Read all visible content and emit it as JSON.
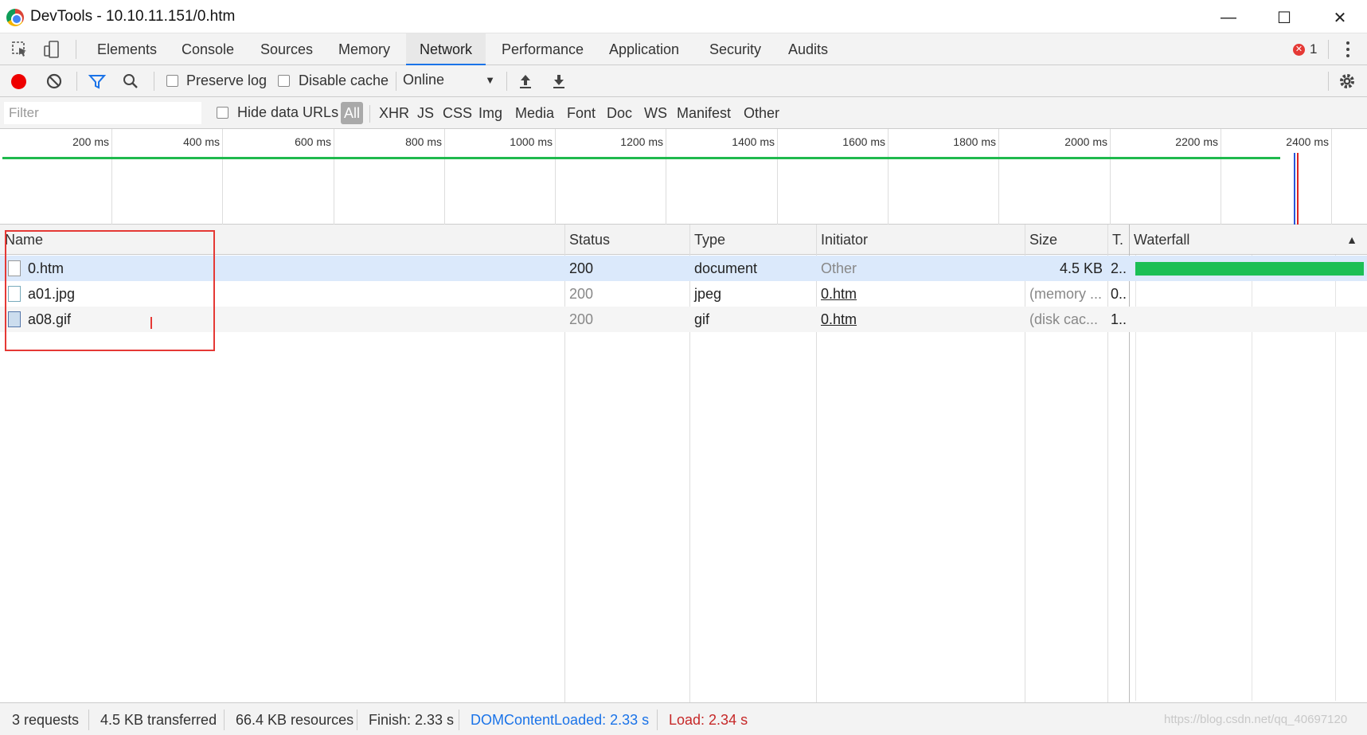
{
  "window": {
    "title": "DevTools - 10.10.11.151/0.htm",
    "minimize_glyph": "—",
    "maximize_glyph": "☐",
    "close_glyph": "✕"
  },
  "tabs": [
    {
      "label": "Elements"
    },
    {
      "label": "Console"
    },
    {
      "label": "Sources"
    },
    {
      "label": "Memory"
    },
    {
      "label": "Network",
      "active": true
    },
    {
      "label": "Performance"
    },
    {
      "label": "Application"
    },
    {
      "label": "Security"
    },
    {
      "label": "Audits"
    }
  ],
  "error_count": "1",
  "toolbar": {
    "preserve_log": "Preserve log",
    "disable_cache": "Disable cache",
    "throttling": "Online"
  },
  "filterbar": {
    "placeholder": "Filter",
    "hide_data_urls": "Hide data URLs",
    "types": [
      "All",
      "XHR",
      "JS",
      "CSS",
      "Img",
      "Media",
      "Font",
      "Doc",
      "WS",
      "Manifest",
      "Other"
    ]
  },
  "overview": {
    "ticks": [
      "200 ms",
      "400 ms",
      "600 ms",
      "800 ms",
      "1000 ms",
      "1200 ms",
      "1400 ms",
      "1600 ms",
      "1800 ms",
      "2000 ms",
      "2200 ms",
      "2400 ms"
    ]
  },
  "table": {
    "headers": {
      "name": "Name",
      "status": "Status",
      "type": "Type",
      "initiator": "Initiator",
      "size": "Size",
      "time": "T.",
      "waterfall": "Waterfall",
      "sort_glyph": "▲"
    },
    "rows": [
      {
        "name": "0.htm",
        "status": "200",
        "type": "document",
        "initiator": "Other",
        "size": "4.5 KB",
        "time": "2..",
        "icon": "document-icon"
      },
      {
        "name": "a01.jpg",
        "status": "200",
        "type": "jpeg",
        "initiator": "0.htm",
        "size": "(memory ...",
        "time": "0..",
        "icon": "image-icon"
      },
      {
        "name": "a08.gif",
        "status": "200",
        "type": "gif",
        "initiator": "0.htm",
        "size": "(disk cac...",
        "time": "1..",
        "icon": "image-icon"
      }
    ]
  },
  "statusbar": {
    "requests": "3 requests",
    "transferred": "4.5 KB transferred",
    "resources": "66.4 KB resources",
    "finish": "Finish: 2.33 s",
    "dom_content_loaded": "DOMContentLoaded: 2.33 s",
    "load": "Load: 2.34 s",
    "watermark": "https://blog.csdn.net/qq_40697120"
  },
  "colors": {
    "dom_content_loaded": "#1a73e8",
    "load": "#c62828",
    "waterfall_bar": "#1bbf55",
    "annotation": "#e53935"
  }
}
